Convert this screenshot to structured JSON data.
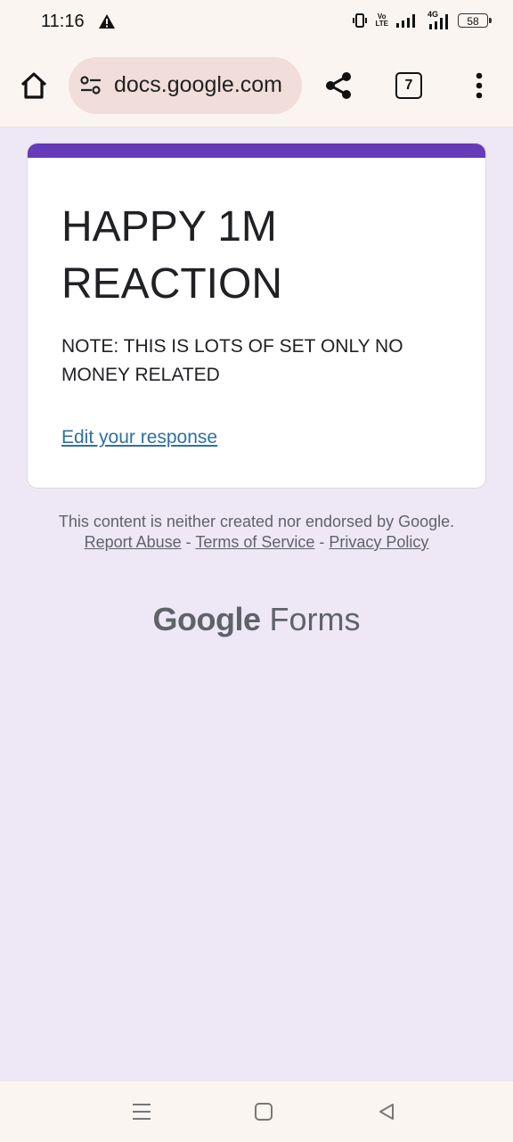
{
  "status_bar": {
    "time": "11:16",
    "volte": "Vo\nLTE",
    "network": "4G",
    "battery": "58"
  },
  "browser": {
    "url": "docs.google.com",
    "tab_count": "7"
  },
  "form": {
    "title": "HAPPY 1M REACTION",
    "description": "NOTE: THIS IS LOTS OF SET ONLY NO MONEY RELATED",
    "edit_link": "Edit your response",
    "accent_color": "#673ab7"
  },
  "footer": {
    "disclaimer": "This content is neither created nor endorsed by Google.",
    "report_abuse": "Report Abuse",
    "sep1": " - ",
    "terms": "Terms of Service",
    "sep2": " - ",
    "privacy": "Privacy Policy"
  },
  "logo": {
    "google": "Google",
    "forms": "Forms"
  }
}
